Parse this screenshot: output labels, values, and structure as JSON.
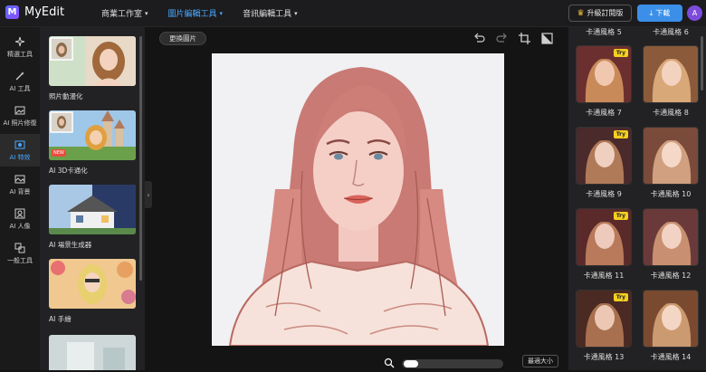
{
  "app": {
    "logo_letter": "M",
    "name": "MyEdit"
  },
  "topnav": [
    {
      "label": "商業工作室"
    },
    {
      "label": "圖片編輯工具"
    },
    {
      "label": "音訊編輯工具"
    }
  ],
  "header": {
    "upgrade_label": "升級訂閱版",
    "download_label": "下載",
    "avatar_letter": "A"
  },
  "rail": [
    {
      "label": "精選工具"
    },
    {
      "label": "AI 工具"
    },
    {
      "label": "AI 照片修復"
    },
    {
      "label": "AI 特效"
    },
    {
      "label": "AI 背景"
    },
    {
      "label": "AI 人像"
    },
    {
      "label": "一般工具"
    }
  ],
  "tools": [
    {
      "label": "照片動漫化"
    },
    {
      "label": "AI 3D卡通化",
      "badge": "NEW"
    },
    {
      "label": "AI 場景生成器"
    },
    {
      "label": "AI 手繪"
    }
  ],
  "canvas": {
    "swap_label": "更換圖片",
    "fit_label": "最適大小",
    "zoom_level": 0.02
  },
  "styles": {
    "top_partial_label": "卡通風格 5",
    "top_partial_label_right": "卡通風格 6",
    "try_label": "Try",
    "items": [
      {
        "label": "卡通風格 7"
      },
      {
        "label": "卡通風格 8"
      },
      {
        "label": "卡通風格 9"
      },
      {
        "label": "卡通風格 10"
      },
      {
        "label": "卡通風格 11"
      },
      {
        "label": "卡通風格 12"
      },
      {
        "label": "卡通風格 13"
      },
      {
        "label": "卡通風格 14"
      }
    ]
  },
  "colors": {
    "accent": "#4aa8ff",
    "download": "#3b8fe8",
    "try_badge": "#f5d020",
    "avatar": "#7d4cdb"
  }
}
